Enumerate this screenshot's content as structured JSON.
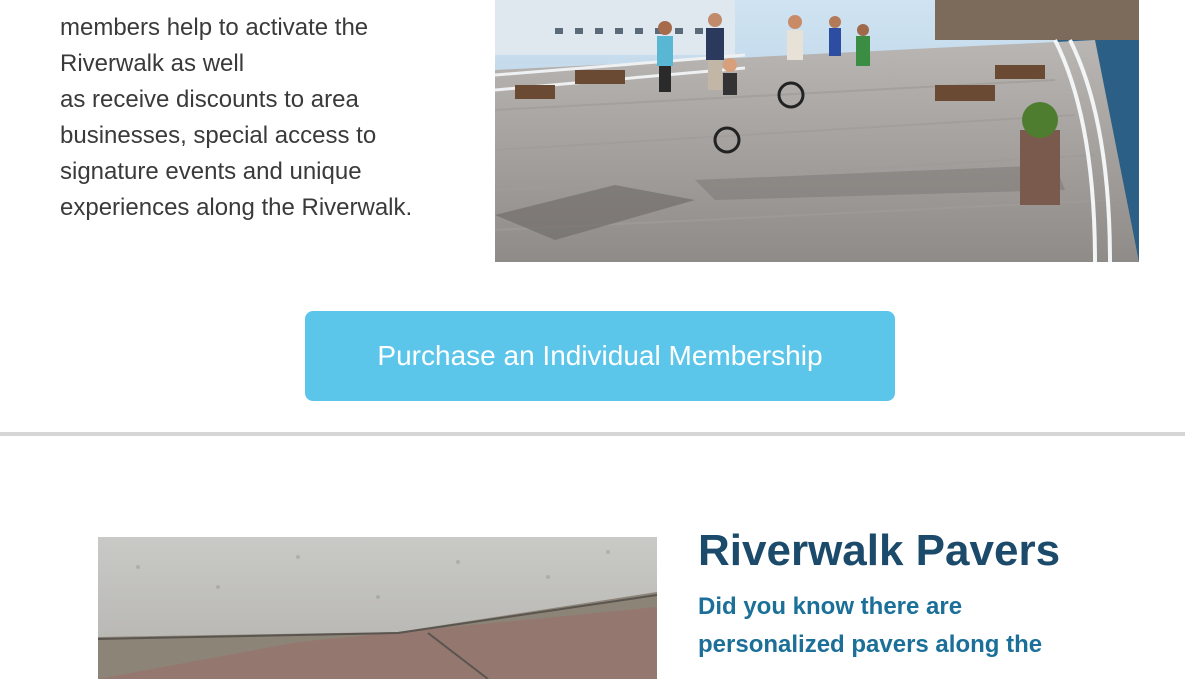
{
  "intro": {
    "lines": [
      "members help to activate the",
      "Riverwalk as well",
      "as receive discounts to area",
      "businesses, special access to",
      "signature events and unique",
      "experiences along the Riverwalk."
    ]
  },
  "membership_button": {
    "label": "Purchase an Individual Membership"
  },
  "pavers": {
    "title": "Riverwalk Pavers",
    "subtitle_lines": [
      "Did you know there are",
      "personalized pavers along the"
    ]
  },
  "colors": {
    "button": "#5bc5ea",
    "title": "#1c4a6a",
    "subtitle": "#1b6f98",
    "divider": "#d6d6d6"
  }
}
